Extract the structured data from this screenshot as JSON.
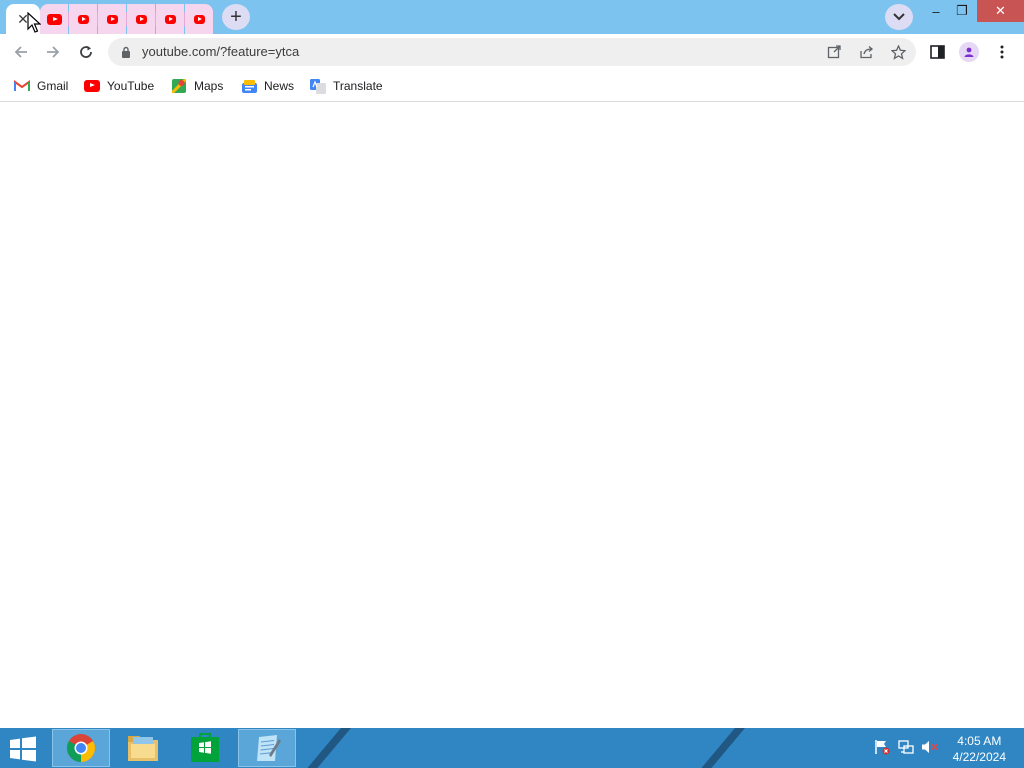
{
  "tabstrip": {
    "tabs": [
      {
        "icon": "close-icon",
        "active": true
      },
      {
        "icon": "youtube-icon",
        "pinned": true
      },
      {
        "icon": "youtube-icon",
        "pinned": true
      },
      {
        "icon": "youtube-icon",
        "pinned": true
      },
      {
        "icon": "youtube-icon",
        "pinned": true
      },
      {
        "icon": "youtube-icon",
        "pinned": true
      },
      {
        "icon": "youtube-icon",
        "pinned": true
      }
    ],
    "new_tab_icon": "plus-icon",
    "tab_search_icon": "chevron-down-icon"
  },
  "window_controls": {
    "minimize": "–",
    "restore": "❐",
    "close": "✕"
  },
  "toolbar": {
    "url": "youtube.com/?feature=ytca",
    "icons": [
      "back-icon",
      "forward-icon",
      "reload-icon",
      "lock-icon",
      "open-in-app-icon",
      "share-icon",
      "bookmark-star-icon",
      "side-panel-icon",
      "profile-icon",
      "menu-icon"
    ]
  },
  "bookmarks": [
    {
      "label": "Gmail",
      "icon": "gmail-icon"
    },
    {
      "label": "YouTube",
      "icon": "youtube-icon"
    },
    {
      "label": "Maps",
      "icon": "maps-icon"
    },
    {
      "label": "News",
      "icon": "news-icon"
    },
    {
      "label": "Translate",
      "icon": "translate-icon"
    }
  ],
  "taskbar": {
    "apps": [
      "chrome-icon",
      "file-explorer-icon",
      "store-icon",
      "notepad-icon"
    ],
    "tray": [
      "flag-icon",
      "network-icon",
      "volume-muted-icon"
    ],
    "clock": {
      "time": "4:05 AM",
      "date": "4/22/2024"
    }
  },
  "colors": {
    "tabstrip": "#7cc4ef",
    "pinned_tab": "#f6d6ee",
    "taskbar": "#2f86c2",
    "youtube_red": "#ff0000"
  }
}
